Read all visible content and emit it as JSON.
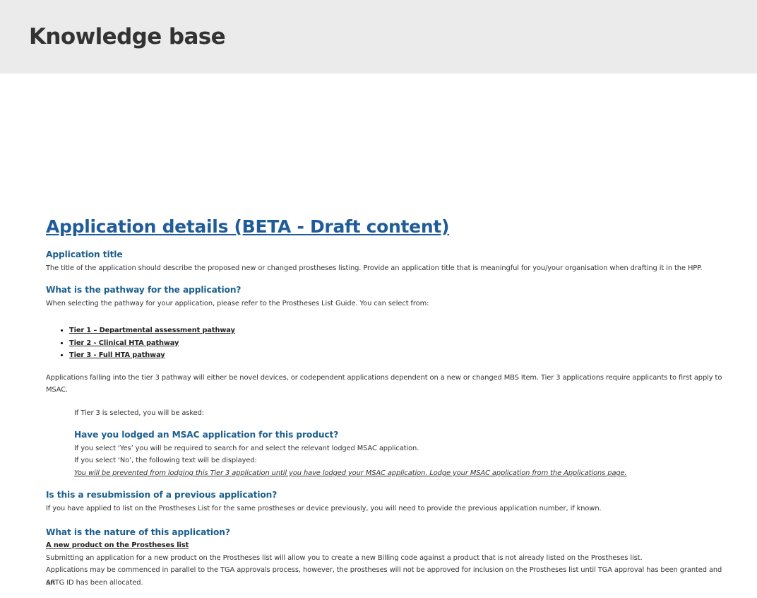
{
  "header": {
    "title": "Knowledge base"
  },
  "article": {
    "title": "Application details (BETA - Draft content)",
    "sections": {
      "app_title": {
        "heading": "Application title",
        "text": "The title of the application should describe the proposed new or changed prostheses listing. Provide an application title that is meaningful for you/your organisation when drafting it in the HPP."
      },
      "pathway": {
        "heading": "What is the pathway for the application?",
        "intro": "When selecting the pathway for your application, please refer to the Prostheses List Guide. You can select from:",
        "tiers": [
          "Tier 1 – Departmental assessment pathway",
          "Tier 2 - Clinical HTA pathway",
          "Tier 3 - Full HTA pathway"
        ],
        "tier3_note_line1": "Applications falling into the tier 3 pathway will either be novel devices, or codependent applications dependent on a new or changed MBS Item. Tier 3 applications require applicants to first apply to",
        "tier3_note_line2": "MSAC.",
        "if_tier3": "If Tier 3 is selected, you will be asked:",
        "msac_heading": "Have you lodged an MSAC application for this product?",
        "msac_yes": "If you select ‘Yes’ you will be required to search for and select the relevant lodged MSAC application.",
        "msac_no": "If you select ‘No’, the following text will be displayed:",
        "msac_warning": "You will be prevented from lodging this Tier 3 application until you have lodged your MSAC application. Lodge your MSAC application from the Applications page."
      },
      "resubmission": {
        "heading": "Is this a resubmission of a previous application?",
        "text": "If you have applied to list on the Prostheses List for the same prostheses or device previously, you will need to provide the previous application number, if known."
      },
      "nature": {
        "heading": "What is the nature of this application?",
        "subheading": "A new product on the Prostheses list",
        "text1": "Submitting an application for a new product on the Prostheses list will allow you to create a new Billing code against a product that is not already listed on the Prostheses list.",
        "text2_line1": "Applications may be commenced in parallel to the TGA approvals process, however, the prostheses will not be approved for inclusion on the Prostheses list until TGA approval has been granted and an",
        "text2_line2": "ARTG ID has been allocated."
      }
    }
  },
  "colors": {
    "banner_bg": "#ebebeb",
    "title_link": "#1f5c99",
    "heading": "#1b5f8e",
    "body_text": "#333333"
  }
}
